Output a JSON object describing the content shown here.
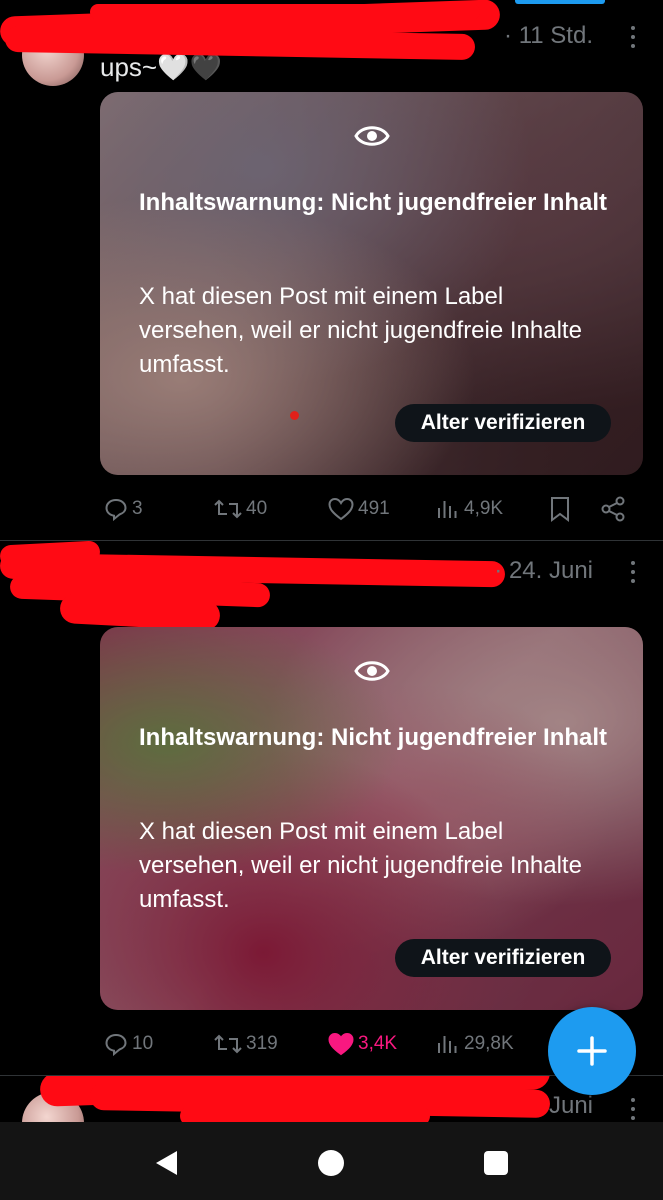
{
  "posts": [
    {
      "timestamp": "11 Std.",
      "text": "ups~🤍🖤",
      "warning_title": "Inhaltswarnung: Nicht jugendfreier Inhalt",
      "warning_body": "X hat diesen Post mit einem Label versehen, weil er nicht jugendfreie Inhalte umfasst.",
      "verify_label": "Alter verifizieren",
      "replies": "3",
      "reposts": "40",
      "likes": "491",
      "views": "4,9K",
      "liked": false
    },
    {
      "timestamp": "24. Juni",
      "text": "",
      "warning_title": "Inhaltswarnung: Nicht jugendfreier Inhalt",
      "warning_body": "X hat diesen Post mit einem Label versehen, weil er nicht jugendfreie Inhalte umfasst.",
      "verify_label": "Alter verifizieren",
      "replies": "10",
      "reposts": "319",
      "likes": "3,4K",
      "views": "29,8K",
      "liked": true
    },
    {
      "timestamp": "23. Juni"
    }
  ],
  "colors": {
    "accent": "#1d9bf0",
    "like": "#f91880",
    "muted": "#71767b",
    "redaction": "#ff0a14"
  },
  "icons": {
    "reply": "reply-icon",
    "repost": "repost-icon",
    "like": "heart-icon",
    "views": "views-icon",
    "bookmark": "bookmark-icon",
    "share": "share-icon",
    "sensitive": "eye-icon",
    "more": "more-icon",
    "compose": "plus-icon",
    "back": "back-icon",
    "home": "home-icon",
    "recents": "recents-icon"
  }
}
